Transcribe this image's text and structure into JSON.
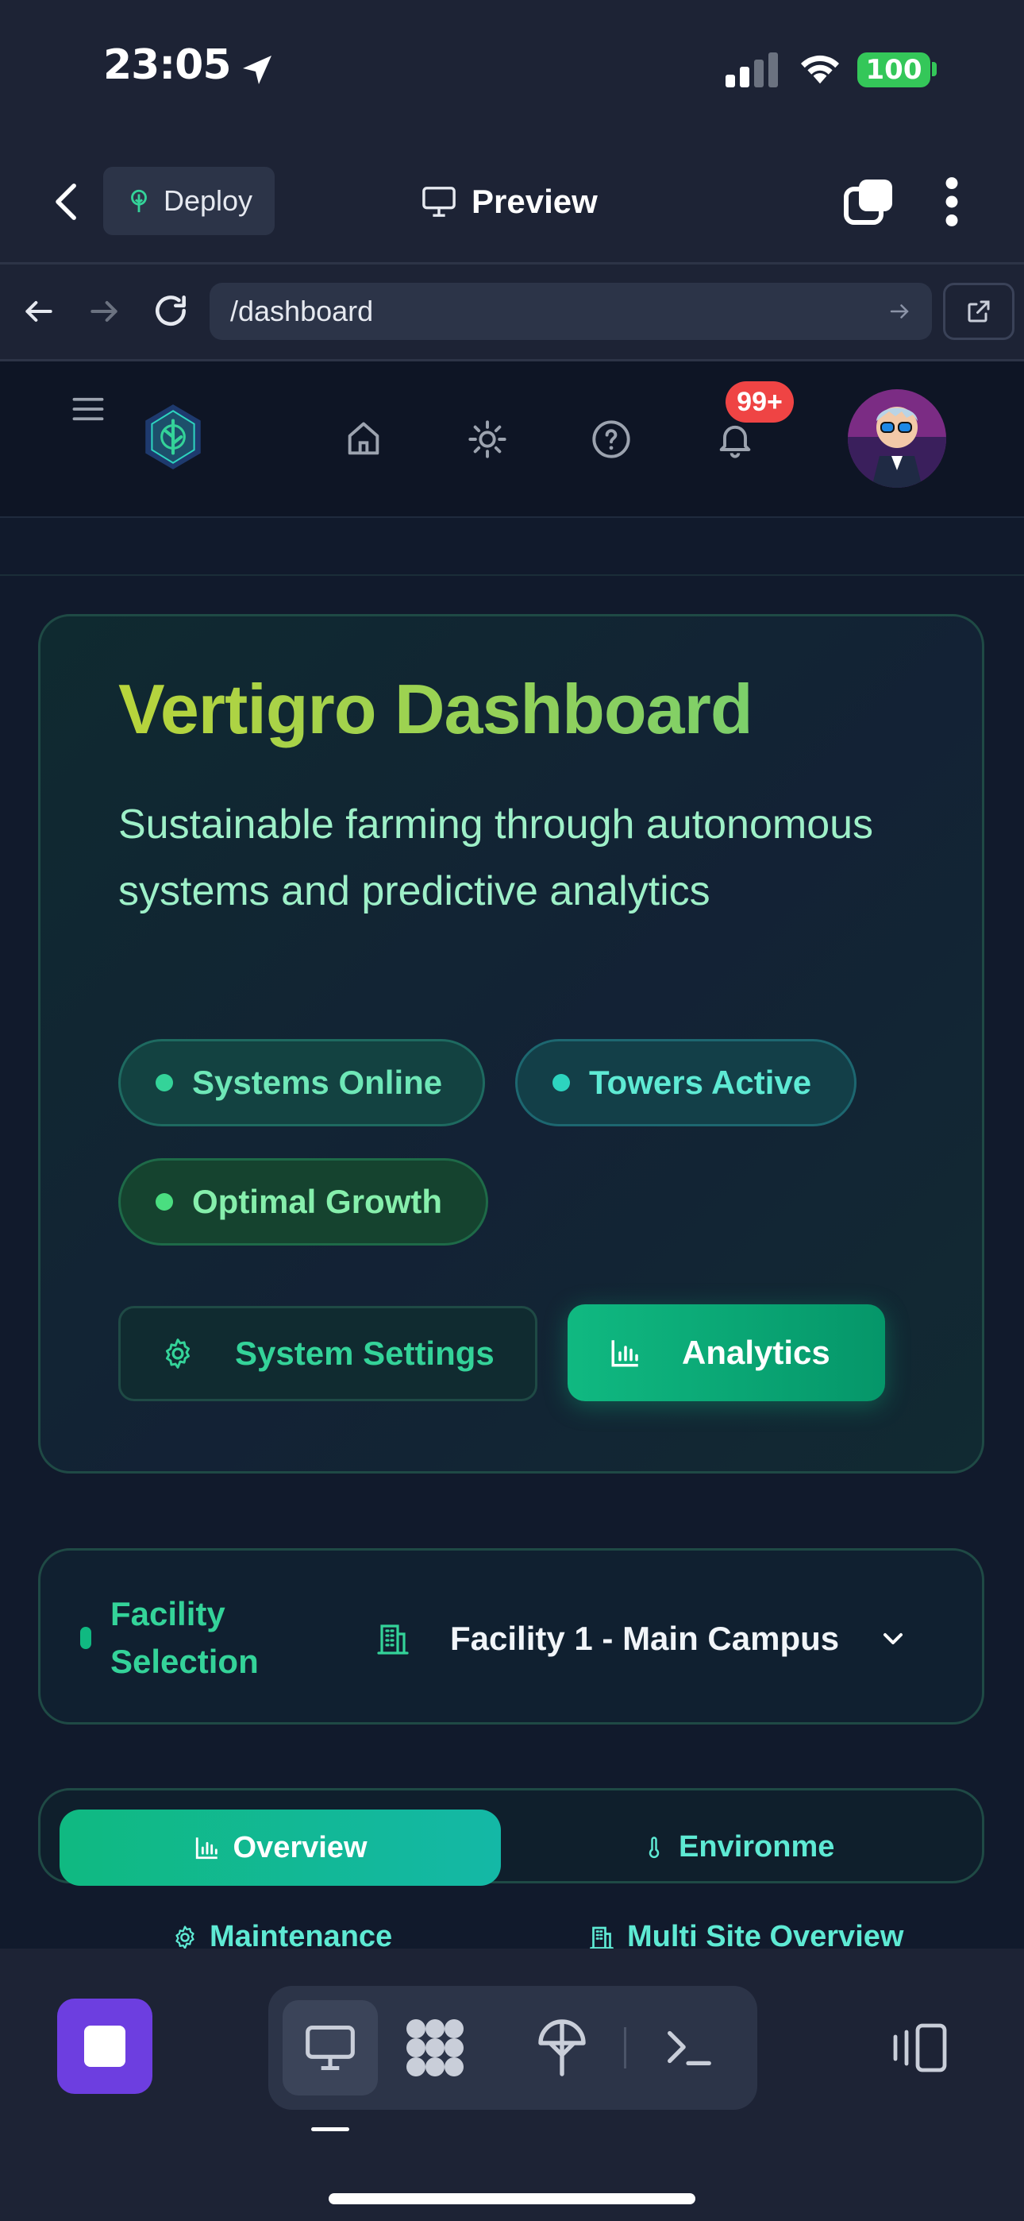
{
  "status_bar": {
    "time": "23:05",
    "battery": "100"
  },
  "preview_header": {
    "deploy_label": "Deploy",
    "title": "Preview"
  },
  "browser": {
    "url": "/dashboard"
  },
  "app_nav": {
    "notification_badge": "99+"
  },
  "hero": {
    "title": "Vertigro Dashboard",
    "subtitle": "Sustainable farming through autonomous systems and predictive analytics",
    "pills": [
      {
        "label": "Systems Online",
        "dot_color": "#34d399"
      },
      {
        "label": "Towers Active",
        "dot_color": "#2dd4bf"
      },
      {
        "label": "Optimal Growth",
        "dot_color": "#4ade80"
      }
    ],
    "settings_button": "System Settings",
    "analytics_button": "Analytics"
  },
  "facility": {
    "label": "Facility Selection",
    "selected": "Facility 1 - Main Campus"
  },
  "tabs": {
    "overview": "Overview",
    "environment": "Environme",
    "maintenance": "Maintenance",
    "multi_site": "Multi Site Overview"
  },
  "colors": {
    "accent": "#10b981",
    "title_gradient_start": "#b8d43b",
    "badge": "#ef4444",
    "stop_button": "#6d3ee0"
  }
}
